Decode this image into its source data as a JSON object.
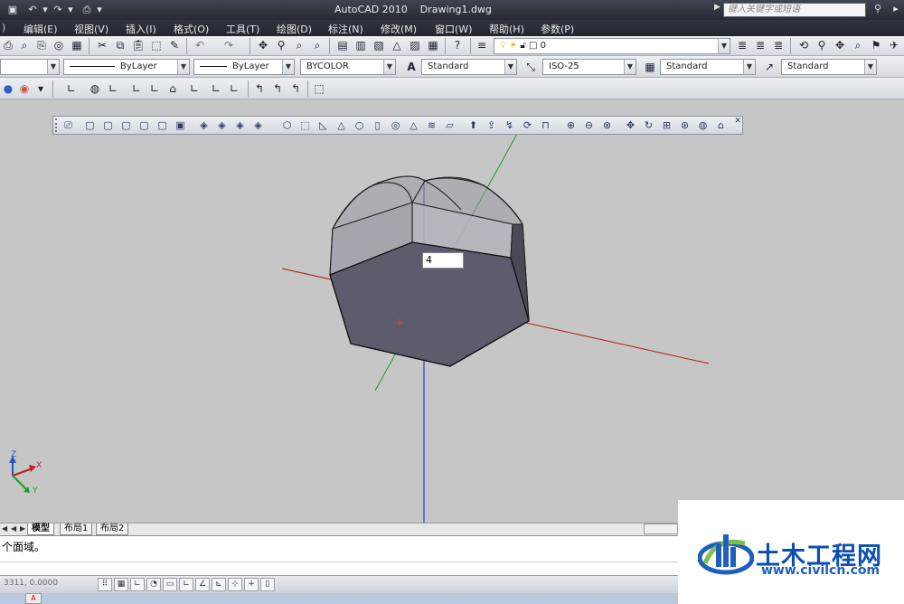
{
  "window": {
    "app_title": "AutoCAD 2010",
    "document": "Drawing1.dwg",
    "search_placeholder": "键入关键字或短语"
  },
  "menu": [
    "编辑(E)",
    "视图(V)",
    "插入(I)",
    "格式(O)",
    "工具(T)",
    "绘图(D)",
    "标注(N)",
    "修改(M)",
    "窗口(W)",
    "帮助(H)",
    "参数(P)"
  ],
  "properties": {
    "layer": "0",
    "color": "",
    "linetype": "ByLayer",
    "lineweight": "ByLayer",
    "plotstyle": "BYCOLOR",
    "text_style": "Standard",
    "dim_style": "ISO-25",
    "table_style": "Standard",
    "multileader_style": "Standard"
  },
  "viewport": {
    "dynamic_input_value": "4",
    "ucs_labels": {
      "x": "X",
      "y": "Y",
      "z": "Z"
    }
  },
  "tabs": {
    "model": "模型",
    "layout1": "布局1",
    "layout2": "布局2"
  },
  "command_line": {
    "history": "个面域。"
  },
  "status": {
    "coords": "3311, 0.0000"
  },
  "watermark": {
    "title": "土木工程网",
    "url": "www.civilcn.com"
  },
  "colors": {
    "canvas": "#c6c6c6",
    "x_axis": "#b01818",
    "y_axis": "#1f9a2a",
    "z_axis": "#1a1acc",
    "solid_top": "#5c5c6c",
    "watermark_blue": "#0b4fb3"
  }
}
